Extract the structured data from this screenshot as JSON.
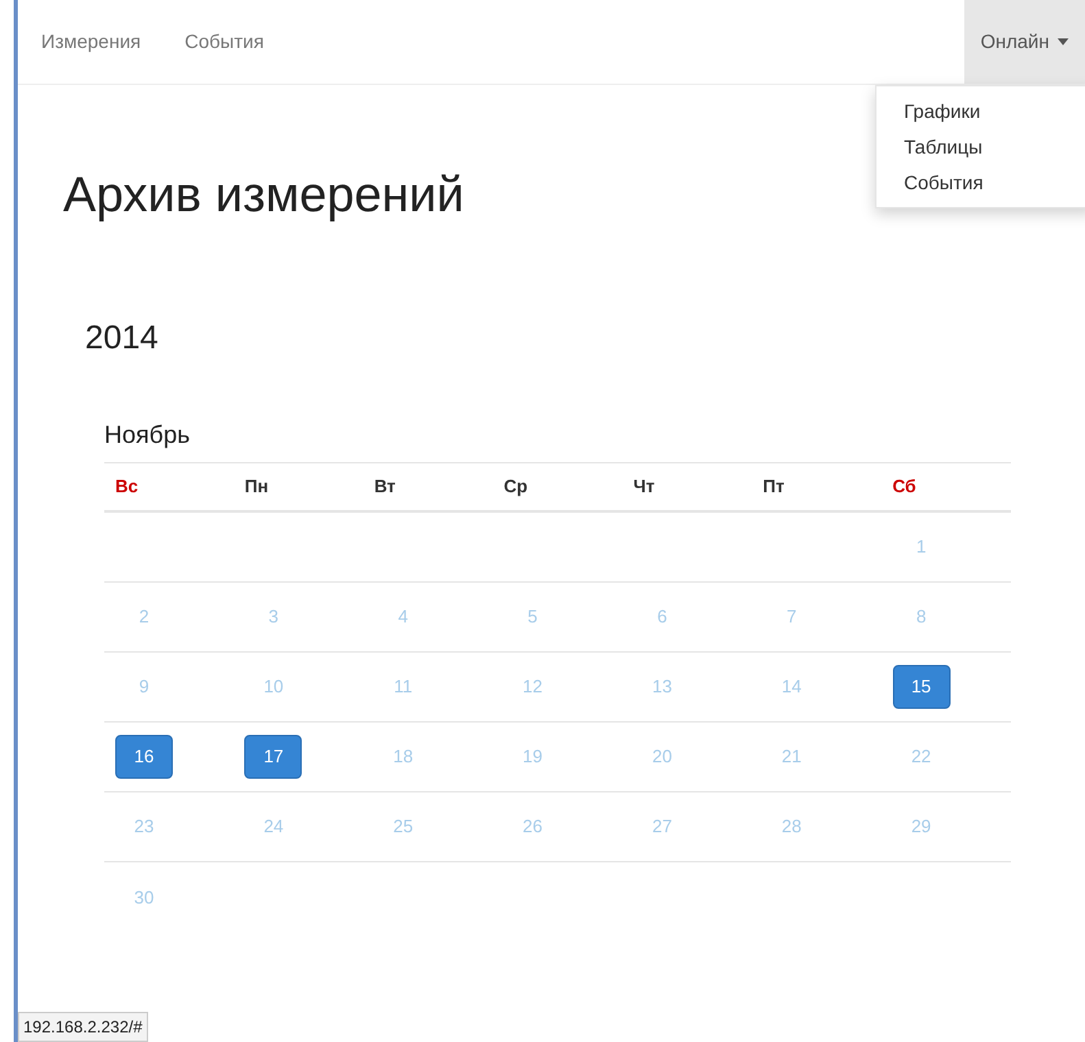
{
  "navbar": {
    "links": [
      {
        "label": "Измерения"
      },
      {
        "label": "События"
      }
    ],
    "dropdown": {
      "label": "Онлайн",
      "expanded": true,
      "items": [
        {
          "label": "Графики"
        },
        {
          "label": "Таблицы"
        },
        {
          "label": "События"
        }
      ]
    }
  },
  "title": "Архив измерений",
  "year": "2014",
  "month": {
    "name": "Ноябрь",
    "weekdays": [
      {
        "label": "Вс",
        "color": "#cc0000"
      },
      {
        "label": "Пн",
        "color": "#333333"
      },
      {
        "label": "Вт",
        "color": "#333333"
      },
      {
        "label": "Ср",
        "color": "#333333"
      },
      {
        "label": "Чт",
        "color": "#333333"
      },
      {
        "label": "Пт",
        "color": "#333333"
      },
      {
        "label": "Сб",
        "color": "#cc0000"
      }
    ],
    "weeks": [
      [
        {
          "kind": "empty"
        },
        {
          "kind": "empty"
        },
        {
          "kind": "empty"
        },
        {
          "kind": "empty"
        },
        {
          "kind": "empty"
        },
        {
          "kind": "empty"
        },
        {
          "kind": "day",
          "day": "1",
          "selected": false
        }
      ],
      [
        {
          "kind": "day",
          "day": "2",
          "selected": false
        },
        {
          "kind": "day",
          "day": "3",
          "selected": false
        },
        {
          "kind": "day",
          "day": "4",
          "selected": false
        },
        {
          "kind": "day",
          "day": "5",
          "selected": false
        },
        {
          "kind": "day",
          "day": "6",
          "selected": false
        },
        {
          "kind": "day",
          "day": "7",
          "selected": false
        },
        {
          "kind": "day",
          "day": "8",
          "selected": false
        }
      ],
      [
        {
          "kind": "day",
          "day": "9",
          "selected": false
        },
        {
          "kind": "day",
          "day": "10",
          "selected": false
        },
        {
          "kind": "day",
          "day": "11",
          "selected": false
        },
        {
          "kind": "day",
          "day": "12",
          "selected": false
        },
        {
          "kind": "day",
          "day": "13",
          "selected": false
        },
        {
          "kind": "day",
          "day": "14",
          "selected": false
        },
        {
          "kind": "day",
          "day": "15",
          "selected": true
        }
      ],
      [
        {
          "kind": "day",
          "day": "16",
          "selected": true
        },
        {
          "kind": "day",
          "day": "17",
          "selected": true
        },
        {
          "kind": "day",
          "day": "18",
          "selected": false
        },
        {
          "kind": "day",
          "day": "19",
          "selected": false
        },
        {
          "kind": "day",
          "day": "20",
          "selected": false
        },
        {
          "kind": "day",
          "day": "21",
          "selected": false
        },
        {
          "kind": "day",
          "day": "22",
          "selected": false
        }
      ],
      [
        {
          "kind": "day",
          "day": "23",
          "selected": false
        },
        {
          "kind": "day",
          "day": "24",
          "selected": false
        },
        {
          "kind": "day",
          "day": "25",
          "selected": false
        },
        {
          "kind": "day",
          "day": "26",
          "selected": false
        },
        {
          "kind": "day",
          "day": "27",
          "selected": false
        },
        {
          "kind": "day",
          "day": "28",
          "selected": false
        },
        {
          "kind": "day",
          "day": "29",
          "selected": false
        }
      ],
      [
        {
          "kind": "day",
          "day": "30",
          "selected": false
        },
        {
          "kind": "empty"
        },
        {
          "kind": "empty"
        },
        {
          "kind": "empty"
        },
        {
          "kind": "empty"
        },
        {
          "kind": "empty"
        },
        {
          "kind": "empty"
        }
      ]
    ]
  },
  "status_bar": {
    "url": "192.168.2.232/#"
  }
}
